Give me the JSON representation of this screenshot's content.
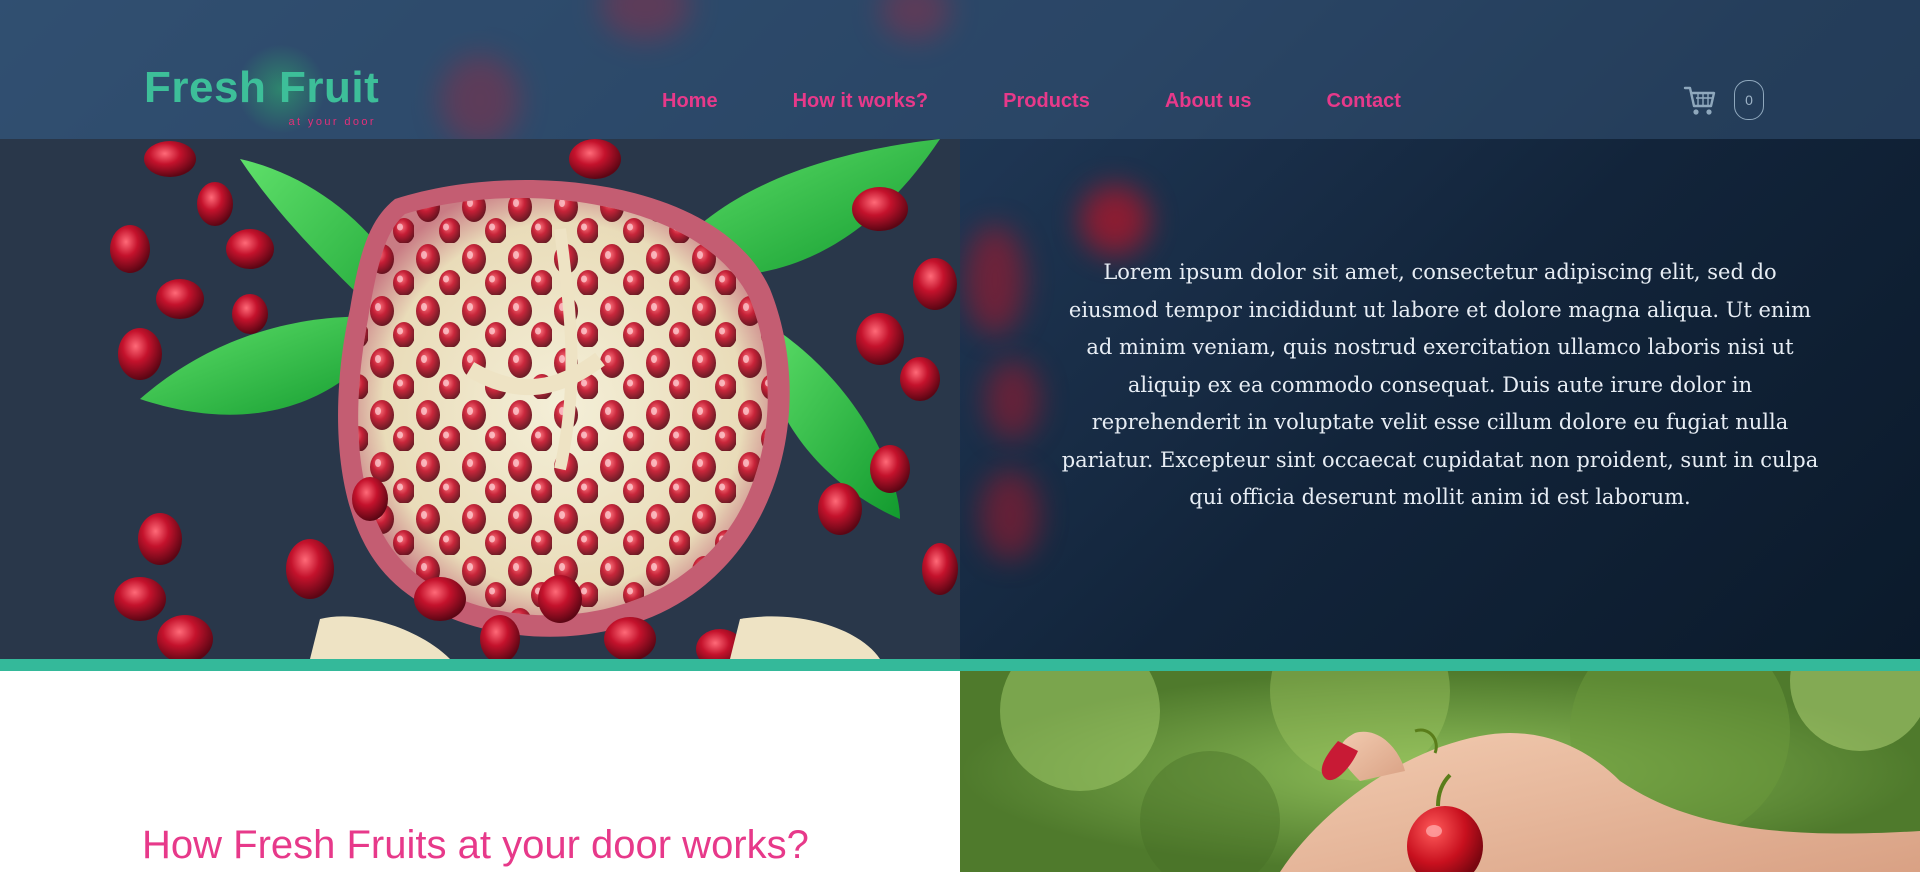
{
  "brand": {
    "name": "Fresh Fruit",
    "tagline": "at your door"
  },
  "nav": {
    "items": [
      {
        "label": "Home"
      },
      {
        "label": "How it works?"
      },
      {
        "label": "Products"
      },
      {
        "label": "About us"
      },
      {
        "label": "Contact"
      }
    ]
  },
  "cart": {
    "icon": "shopping-cart-icon",
    "count": "0"
  },
  "hero": {
    "image": "pomegranate-photo",
    "paragraph": "Lorem ipsum dolor sit amet, consectetur adipiscing elit, sed do eiusmod tempor incididunt ut labore et dolore magna aliqua. Ut enim ad minim veniam, quis nostrud exercitation ullamco laboris nisi ut aliquip ex ea commodo consequat. Duis aute irure dolor in reprehenderit in voluptate velit esse cillum dolore eu fugiat nulla pariatur. Excepteur sint occaecat cupidatat non proident, sunt in culpa qui officia deserunt mollit anim id est laborum."
  },
  "how_it_works": {
    "title": "How Fresh Fruits at your door works?",
    "image": "hand-holding-cherry-photo"
  },
  "colors": {
    "accent_green": "#34b99a",
    "accent_pink": "#e7398a",
    "hero_dark": "#0d1d2f"
  }
}
